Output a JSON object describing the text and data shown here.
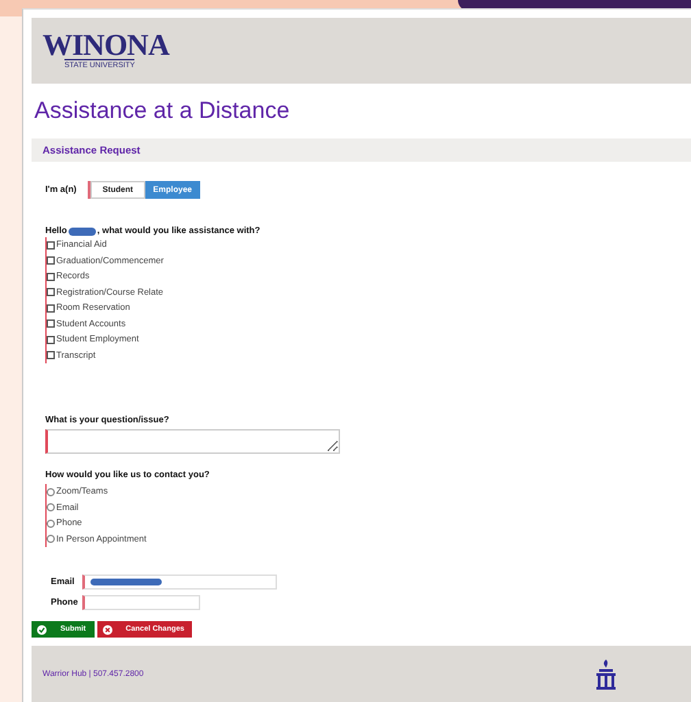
{
  "header": {
    "logo_title": "WINONA",
    "logo_subtitle": "STATE UNIVERSITY"
  },
  "page_title": "Assistance at a Distance",
  "section_title": "Assistance Request",
  "role": {
    "label": "I'm a(n)",
    "options": [
      {
        "label": "Student",
        "selected": false
      },
      {
        "label": "Employee",
        "selected": true
      }
    ]
  },
  "topics": {
    "prompt_before": "Hello",
    "prompt_after": ", what would you like assistance with?",
    "options": [
      {
        "label": "Financial Aid",
        "checked": false
      },
      {
        "label": "Graduation/Commencemer",
        "checked": false
      },
      {
        "label": "Records",
        "checked": false
      },
      {
        "label": "Registration/Course Relate",
        "checked": false
      },
      {
        "label": "Room Reservation",
        "checked": false
      },
      {
        "label": "Student Accounts",
        "checked": false
      },
      {
        "label": "Student Employment",
        "checked": false
      },
      {
        "label": "Transcript",
        "checked": false
      }
    ]
  },
  "question": {
    "label": "What is your question/issue?"
  },
  "contact": {
    "label": "How would you like us to contact you?",
    "options": [
      {
        "label": "Zoom/Teams",
        "selected": false
      },
      {
        "label": "Email",
        "selected": false
      },
      {
        "label": "Phone",
        "selected": false
      },
      {
        "label": "In Person Appointment",
        "selected": false
      }
    ]
  },
  "fields": [
    {
      "label": "Email",
      "kind": "redacted"
    },
    {
      "label": "Phone",
      "kind": "empty"
    }
  ],
  "buttons": [
    {
      "label": "Submit",
      "kind": "submit"
    },
    {
      "label": "Cancel Changes",
      "kind": "cancel"
    }
  ],
  "footer": {
    "text": "Warrior Hub | 507.457.2800"
  }
}
